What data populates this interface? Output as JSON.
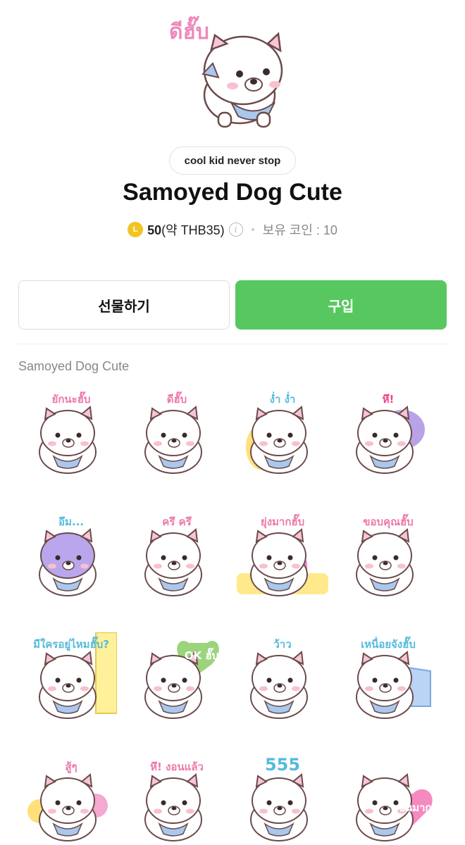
{
  "hero": {
    "caption": "ดีฮั๊บ",
    "icon": "samoyed-sticker-main"
  },
  "tag": "cool kid never stop",
  "title": "Samoyed Dog Cute",
  "price": {
    "coin_icon_letter": "L",
    "amount": "50",
    "approx": "(약 THB35)",
    "owned_label": "보유 코인 : 10"
  },
  "buttons": {
    "gift": "선물하기",
    "buy": "구입"
  },
  "colors": {
    "buy": "#56c85f",
    "coin": "#f2c422"
  },
  "section_label": "Samoyed Dog Cute",
  "stickers": [
    {
      "caption": "ยักนะฮั๊บ",
      "caption_color": "#ee77aa",
      "prop": "heart"
    },
    {
      "caption": "ดีฮั๊บ",
      "caption_color": "#ee77aa",
      "prop": "scarf"
    },
    {
      "caption": "ง่ำ ง่ำ",
      "caption_color": "#55bbdd",
      "prop": "pillow"
    },
    {
      "caption": "หึ!",
      "caption_color": "#ee4488",
      "prop": "purple"
    },
    {
      "caption": "อึม...",
      "caption_color": "#55bbdd",
      "prop": "purple-face"
    },
    {
      "caption": "ครึ ครึ",
      "caption_color": "#ee77aa",
      "prop": "flowers"
    },
    {
      "caption": "ยุ่งมากฮั๊บ",
      "caption_color": "#ee77aa",
      "prop": "laptop"
    },
    {
      "caption": "ขอบคุณฮั๊บ",
      "caption_color": "#ee77aa",
      "prop": "stars"
    },
    {
      "caption": "มีใครอยู่ไหมฮั๊บ?",
      "caption_color": "#55bbdd",
      "prop": "door"
    },
    {
      "caption": "OK ฮั๊บ",
      "caption_color": "#ffffff",
      "prop": "ok"
    },
    {
      "caption": "ว้าว",
      "caption_color": "#55bbdd",
      "prop": "sparkle"
    },
    {
      "caption": "เหนื่อยจังฮั๊บ",
      "caption_color": "#55bbdd",
      "prop": "blanket"
    },
    {
      "caption": "สู้ๆ",
      "caption_color": "#ee77aa",
      "prop": "pompom"
    },
    {
      "caption": "หึ! งอนแล้ว",
      "caption_color": "#ee77aa",
      "prop": "angry"
    },
    {
      "caption": "555",
      "caption_color": "#55bbdd",
      "prop": "laugh"
    },
    {
      "caption": "เขินมาก",
      "caption_color": "#ffffff",
      "prop": "heart-sign"
    }
  ]
}
